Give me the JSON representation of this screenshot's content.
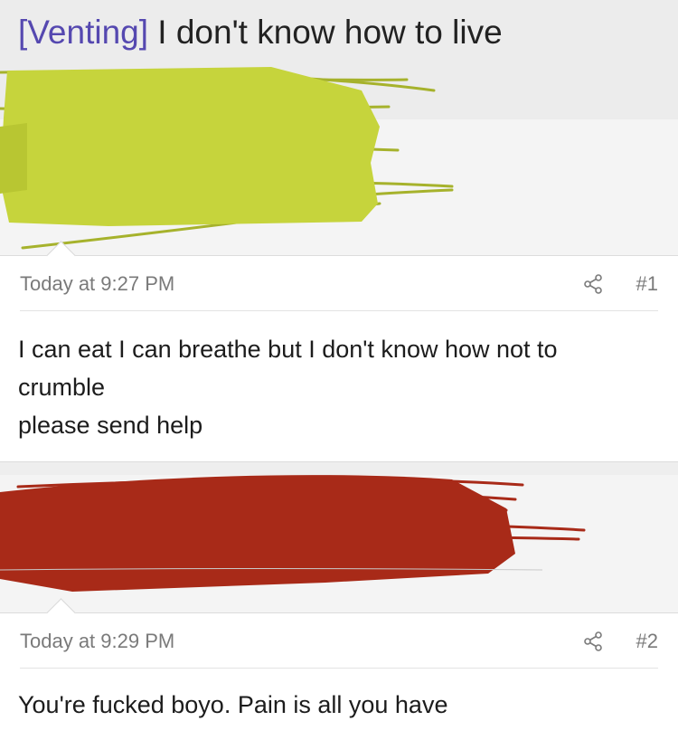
{
  "thread": {
    "prefix": "[Venting]",
    "title": "I don't know how to live"
  },
  "posts": [
    {
      "timestamp": "Today at 9:27 PM",
      "number": "#1",
      "lines": [
        "I can eat I can breathe but I don't know how not to",
        "crumble",
        "please send help"
      ]
    },
    {
      "timestamp": "Today at 9:29 PM",
      "number": "#2",
      "lines": [
        "You're fucked boyo. Pain is all you have"
      ]
    }
  ],
  "colors": {
    "scribble_green": "#c6d43c",
    "scribble_red": "#a82a18",
    "prefix_purple": "#5548b0"
  },
  "icons": {
    "share": "share-icon"
  }
}
